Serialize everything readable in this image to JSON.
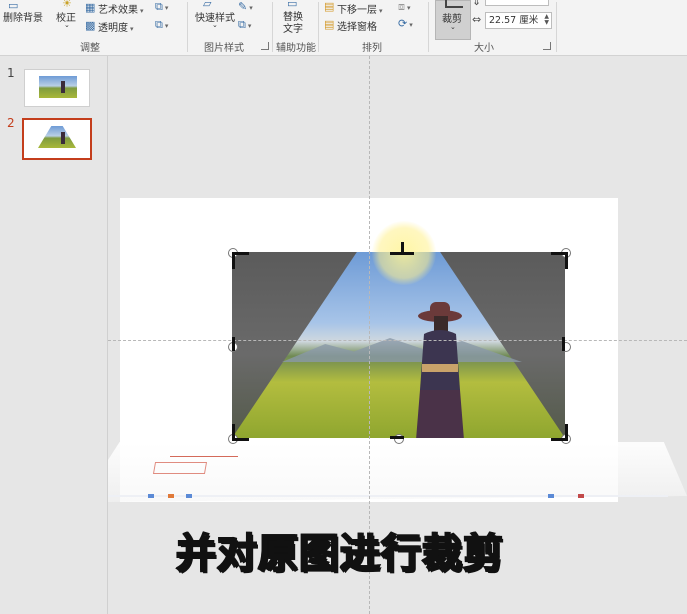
{
  "ribbon": {
    "remove_background": "删除背景",
    "corrections": "校正",
    "artistic_effects": "艺术效果",
    "transparency": "透明度",
    "adjust_group": "调整",
    "quick_styles": "快速样式",
    "picture_styles_group": "图片样式",
    "alt_text_line1": "替换",
    "alt_text_line2": "文字",
    "accessibility_group": "辅助功能",
    "send_backward": "下移一层",
    "selection_pane": "选择窗格",
    "arrange_group": "排列",
    "crop": "裁剪",
    "width_value": "22.57 厘米",
    "size_group": "大小"
  },
  "slides": [
    {
      "number": "1"
    },
    {
      "number": "2",
      "active": true
    }
  ],
  "caption": "并对原图进行裁剪",
  "colors": {
    "accent": "#c43e1c",
    "ribbon_bg": "#f3f3f3",
    "workspace_bg": "#e6e6e6"
  }
}
